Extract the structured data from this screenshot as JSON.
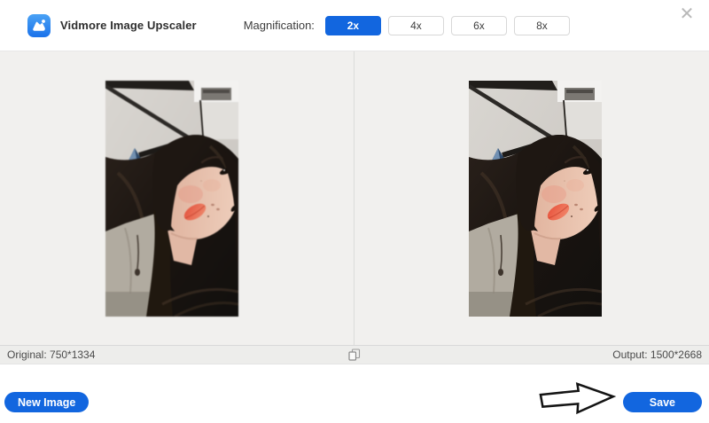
{
  "header": {
    "app_title": "Vidmore Image Upscaler",
    "magnification_label": "Magnification:",
    "magnification_options": [
      {
        "label": "2x",
        "selected": true
      },
      {
        "label": "4x",
        "selected": false
      },
      {
        "label": "6x",
        "selected": false
      },
      {
        "label": "8x",
        "selected": false
      }
    ],
    "close_glyph": "✕"
  },
  "viewer": {
    "left_panel": "original-image-preview",
    "right_panel": "upscaled-image-preview"
  },
  "status_bar": {
    "original_info": "Original: 750*1334",
    "output_info": "Output: 1500*2668"
  },
  "footer": {
    "new_image_label": "New Image",
    "save_label": "Save"
  },
  "icons": {
    "logo": "vidmore-photo-mark",
    "close": "close-x",
    "compare": "overlapping-squares",
    "arrow": "hand-drawn-right-arrow"
  },
  "colors": {
    "accent_blue": "#1266df",
    "panel_bg": "#f1f0ee",
    "status_bg": "#ededeb"
  }
}
